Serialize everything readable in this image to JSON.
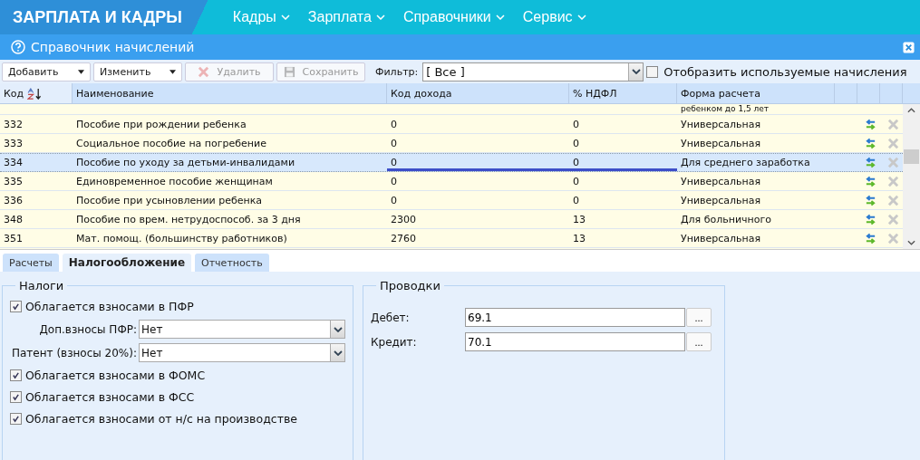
{
  "app": {
    "title": "ЗАРПЛАТА И КАДРЫ",
    "menu": [
      {
        "label": "Кадры"
      },
      {
        "label": "Зарплата"
      },
      {
        "label": "Справочники"
      },
      {
        "label": "Сервис"
      }
    ]
  },
  "panel": {
    "title": "Справочник начислений"
  },
  "toolbar": {
    "buttons": [
      {
        "label": "Добавить",
        "kind": "dropdown",
        "disabled": false
      },
      {
        "label": "Изменить",
        "kind": "dropdown",
        "disabled": false
      },
      {
        "label": "Удалить",
        "kind": "delete",
        "disabled": true
      },
      {
        "label": "Сохранить",
        "kind": "save",
        "disabled": true
      }
    ],
    "filter_label": "Фильтр:",
    "filter_value": "[ Все ]",
    "show_used": {
      "label": "Отобразить используемые начисления",
      "checked": false
    }
  },
  "table": {
    "columns": [
      "Код",
      "Наименование",
      "Код дохода",
      "% НДФЛ",
      "Форма расчета"
    ],
    "partial_top": "ребенком до 1,5 лет",
    "rows": [
      {
        "code": "332",
        "name": "Пособие при рождении ребенка",
        "income_code": "0",
        "ndfl": "0",
        "form": "Универсальная",
        "selected": false
      },
      {
        "code": "333",
        "name": "Социальное пособие на погребение",
        "income_code": "0",
        "ndfl": "0",
        "form": "Универсальная",
        "selected": false
      },
      {
        "code": "334",
        "name": "Пособие по уходу за детьми-инвалидами",
        "income_code": "0",
        "ndfl": "0",
        "form": "Для среднего заработка",
        "selected": true
      },
      {
        "code": "335",
        "name": "Единовременное пособие женщинам",
        "income_code": "0",
        "ndfl": "0",
        "form": "Универсальная",
        "selected": false
      },
      {
        "code": "336",
        "name": "Пособие при усыновлении ребенка",
        "income_code": "0",
        "ndfl": "0",
        "form": "Универсальная",
        "selected": false
      },
      {
        "code": "348",
        "name": "Пособие по врем. нетрудоспособ. за 3 дня",
        "income_code": "2300",
        "ndfl": "13",
        "form": "Для больничного",
        "selected": false
      },
      {
        "code": "351",
        "name": "Мат. помощ. (большинству работников)",
        "income_code": "2760",
        "ndfl": "13",
        "form": "Универсальная",
        "selected": false
      }
    ]
  },
  "tabs": [
    {
      "label": "Расчеты",
      "selected": false
    },
    {
      "label": "Налогообложение",
      "selected": true
    },
    {
      "label": "Отчетность",
      "selected": false
    }
  ],
  "taxes": {
    "title": "Налоги",
    "items": [
      {
        "kind": "checkbox",
        "label": "Облагается взносами в ПФР",
        "checked": true
      },
      {
        "kind": "select",
        "label": "Доп.взносы ПФР:",
        "value": "Нет"
      },
      {
        "kind": "select",
        "label": "Патент (взносы 20%):",
        "value": "Нет"
      },
      {
        "kind": "checkbox",
        "label": "Облагается взносами в ФОМС",
        "checked": true
      },
      {
        "kind": "checkbox",
        "label": "Облагается взносами в ФСС",
        "checked": true
      },
      {
        "kind": "checkbox",
        "label": "Облагается взносами от н/с на производстве",
        "checked": true
      }
    ]
  },
  "postings": {
    "title": "Проводки",
    "fields": [
      {
        "label": "Дебет:",
        "value": "69.1",
        "button": "..."
      },
      {
        "label": "Кредит:",
        "value": "70.1",
        "button": "..."
      }
    ]
  }
}
